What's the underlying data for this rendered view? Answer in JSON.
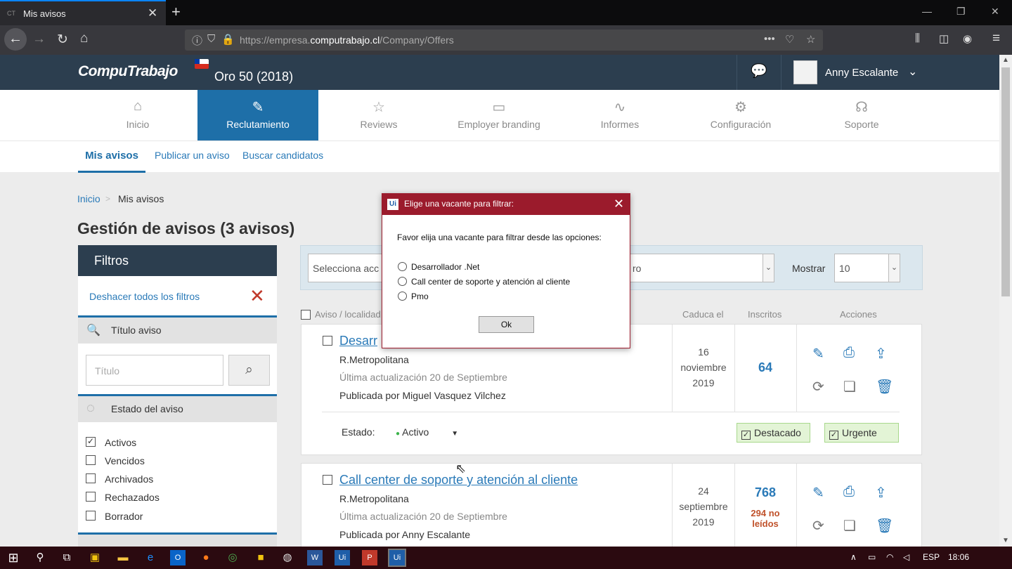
{
  "browser": {
    "tab_title": "Mis avisos",
    "tab_favicon": "CT",
    "url_prefix": "https://empresa.",
    "url_domain": "computrabajo.cl",
    "url_path": "/Company/Offers"
  },
  "header": {
    "logo": "CompuTrabajo",
    "plan": "Oro 50 (2018)",
    "user": "Anny Escalante"
  },
  "mainnav": [
    {
      "label": "Inicio",
      "icon": "home-icon",
      "glyph": "⌂"
    },
    {
      "label": "Reclutamiento",
      "icon": "edit-icon",
      "glyph": "✎"
    },
    {
      "label": "Reviews",
      "icon": "star-icon",
      "glyph": "☆"
    },
    {
      "label": "Employer branding",
      "icon": "monitor-icon",
      "glyph": "▭"
    },
    {
      "label": "Informes",
      "icon": "chart-icon",
      "glyph": "∿"
    },
    {
      "label": "Configuración",
      "icon": "gear-icon",
      "glyph": "⚙"
    },
    {
      "label": "Soporte",
      "icon": "headset-icon",
      "glyph": "☊"
    }
  ],
  "subnav": {
    "active": "Mis avisos",
    "publicar": "Publicar un aviso",
    "buscar": "Buscar candidatos"
  },
  "breadcrumb": {
    "home": "Inicio",
    "current": "Mis avisos"
  },
  "page_title": "Gestión de avisos (3 avisos)",
  "filters": {
    "title": "Filtros",
    "undo": "Deshacer todos los filtros",
    "titulo_section": "Título aviso",
    "titulo_placeholder": "Título",
    "estado_section": "Estado del aviso",
    "estados": [
      {
        "label": "Activos",
        "checked": "✓"
      },
      {
        "label": "Vencidos",
        "checked": ""
      },
      {
        "label": "Archivados",
        "checked": ""
      },
      {
        "label": "Rechazados",
        "checked": ""
      },
      {
        "label": "Borrador",
        "checked": ""
      }
    ]
  },
  "toolbar": {
    "select1": "Selecciona acc",
    "select2": "ro",
    "mostrar_label": "Mostrar",
    "mostrar_value": "10"
  },
  "columns": {
    "aviso": "Aviso / localidad",
    "caduca": "Caduca el",
    "inscritos": "Inscritos",
    "acciones": "Acciones"
  },
  "jobs": [
    {
      "title": "Desarr",
      "location": "R.Metropolitana",
      "updated": "Última actualización 20 de Septiembre",
      "publisher": "Publicada por Miguel Vasquez Vilchez",
      "date_day": "16",
      "date_month": "noviembre",
      "date_year": "2019",
      "inscritos": "64",
      "estado_label": "Estado:",
      "estado_value": "Activo",
      "tag1": "Destacado",
      "tag2": "Urgente"
    },
    {
      "title": "Call center de soporte y atención al cliente",
      "location": "R.Metropolitana",
      "updated": "Última actualización 20 de Septiembre",
      "publisher": "Publicada por Anny Escalante",
      "date_day": "24",
      "date_month": "septiembre",
      "date_year": "2019",
      "inscritos": "768",
      "unread_1": "294 no",
      "unread_2": "leídos"
    }
  ],
  "dialog": {
    "title": "Elige una vacante para filtrar:",
    "icon": "Ui",
    "message": "Favor elija una vacante para filtrar desde las opciones:",
    "options": [
      "Desarrollador .Net",
      "Call center de soporte y atención al cliente",
      "Pmo"
    ],
    "ok": "Ok"
  },
  "taskbar": {
    "lang": "ESP",
    "time": "18:06"
  },
  "colors": {
    "header": "#2c3e4f",
    "accent": "#1e6fa8",
    "dialog_title": "#9b1b2c",
    "taskbar": "#2b0a10"
  }
}
